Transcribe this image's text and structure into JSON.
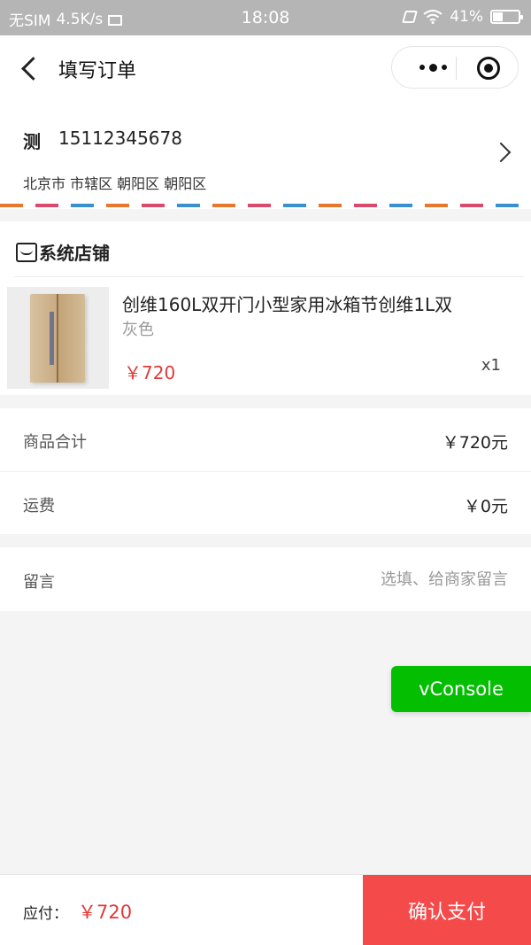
{
  "statusbar": {
    "carrier": "无SIM",
    "speed": "4.5K/s",
    "time": "18:08",
    "battery": "41%",
    "battery_level": 0.41
  },
  "navbar": {
    "title": "填写订单"
  },
  "address": {
    "name": "测",
    "phone": "15112345678",
    "detail": "北京市 市辖区 朝阳区 朝阳区"
  },
  "store": {
    "name": "系统店铺",
    "product": {
      "title": "创维160L双开门小型家用冰箱节创维1L双",
      "spec": "灰色",
      "price": "￥720",
      "qty": "x1"
    }
  },
  "summary": {
    "subtotal_label": "商品合计",
    "subtotal_value": "￥720元",
    "shipping_label": "运费",
    "shipping_value": "￥0元"
  },
  "message": {
    "label": "留言",
    "placeholder": "选填、给商家留言"
  },
  "vconsole": {
    "label": "vConsole"
  },
  "bottom": {
    "pay_label": "应付：",
    "pay_amount": "￥720",
    "confirm_label": "确认支付"
  },
  "colors": {
    "accent_red": "#f44a49",
    "price_red": "#e03a3a",
    "vconsole_green": "#04be02"
  }
}
